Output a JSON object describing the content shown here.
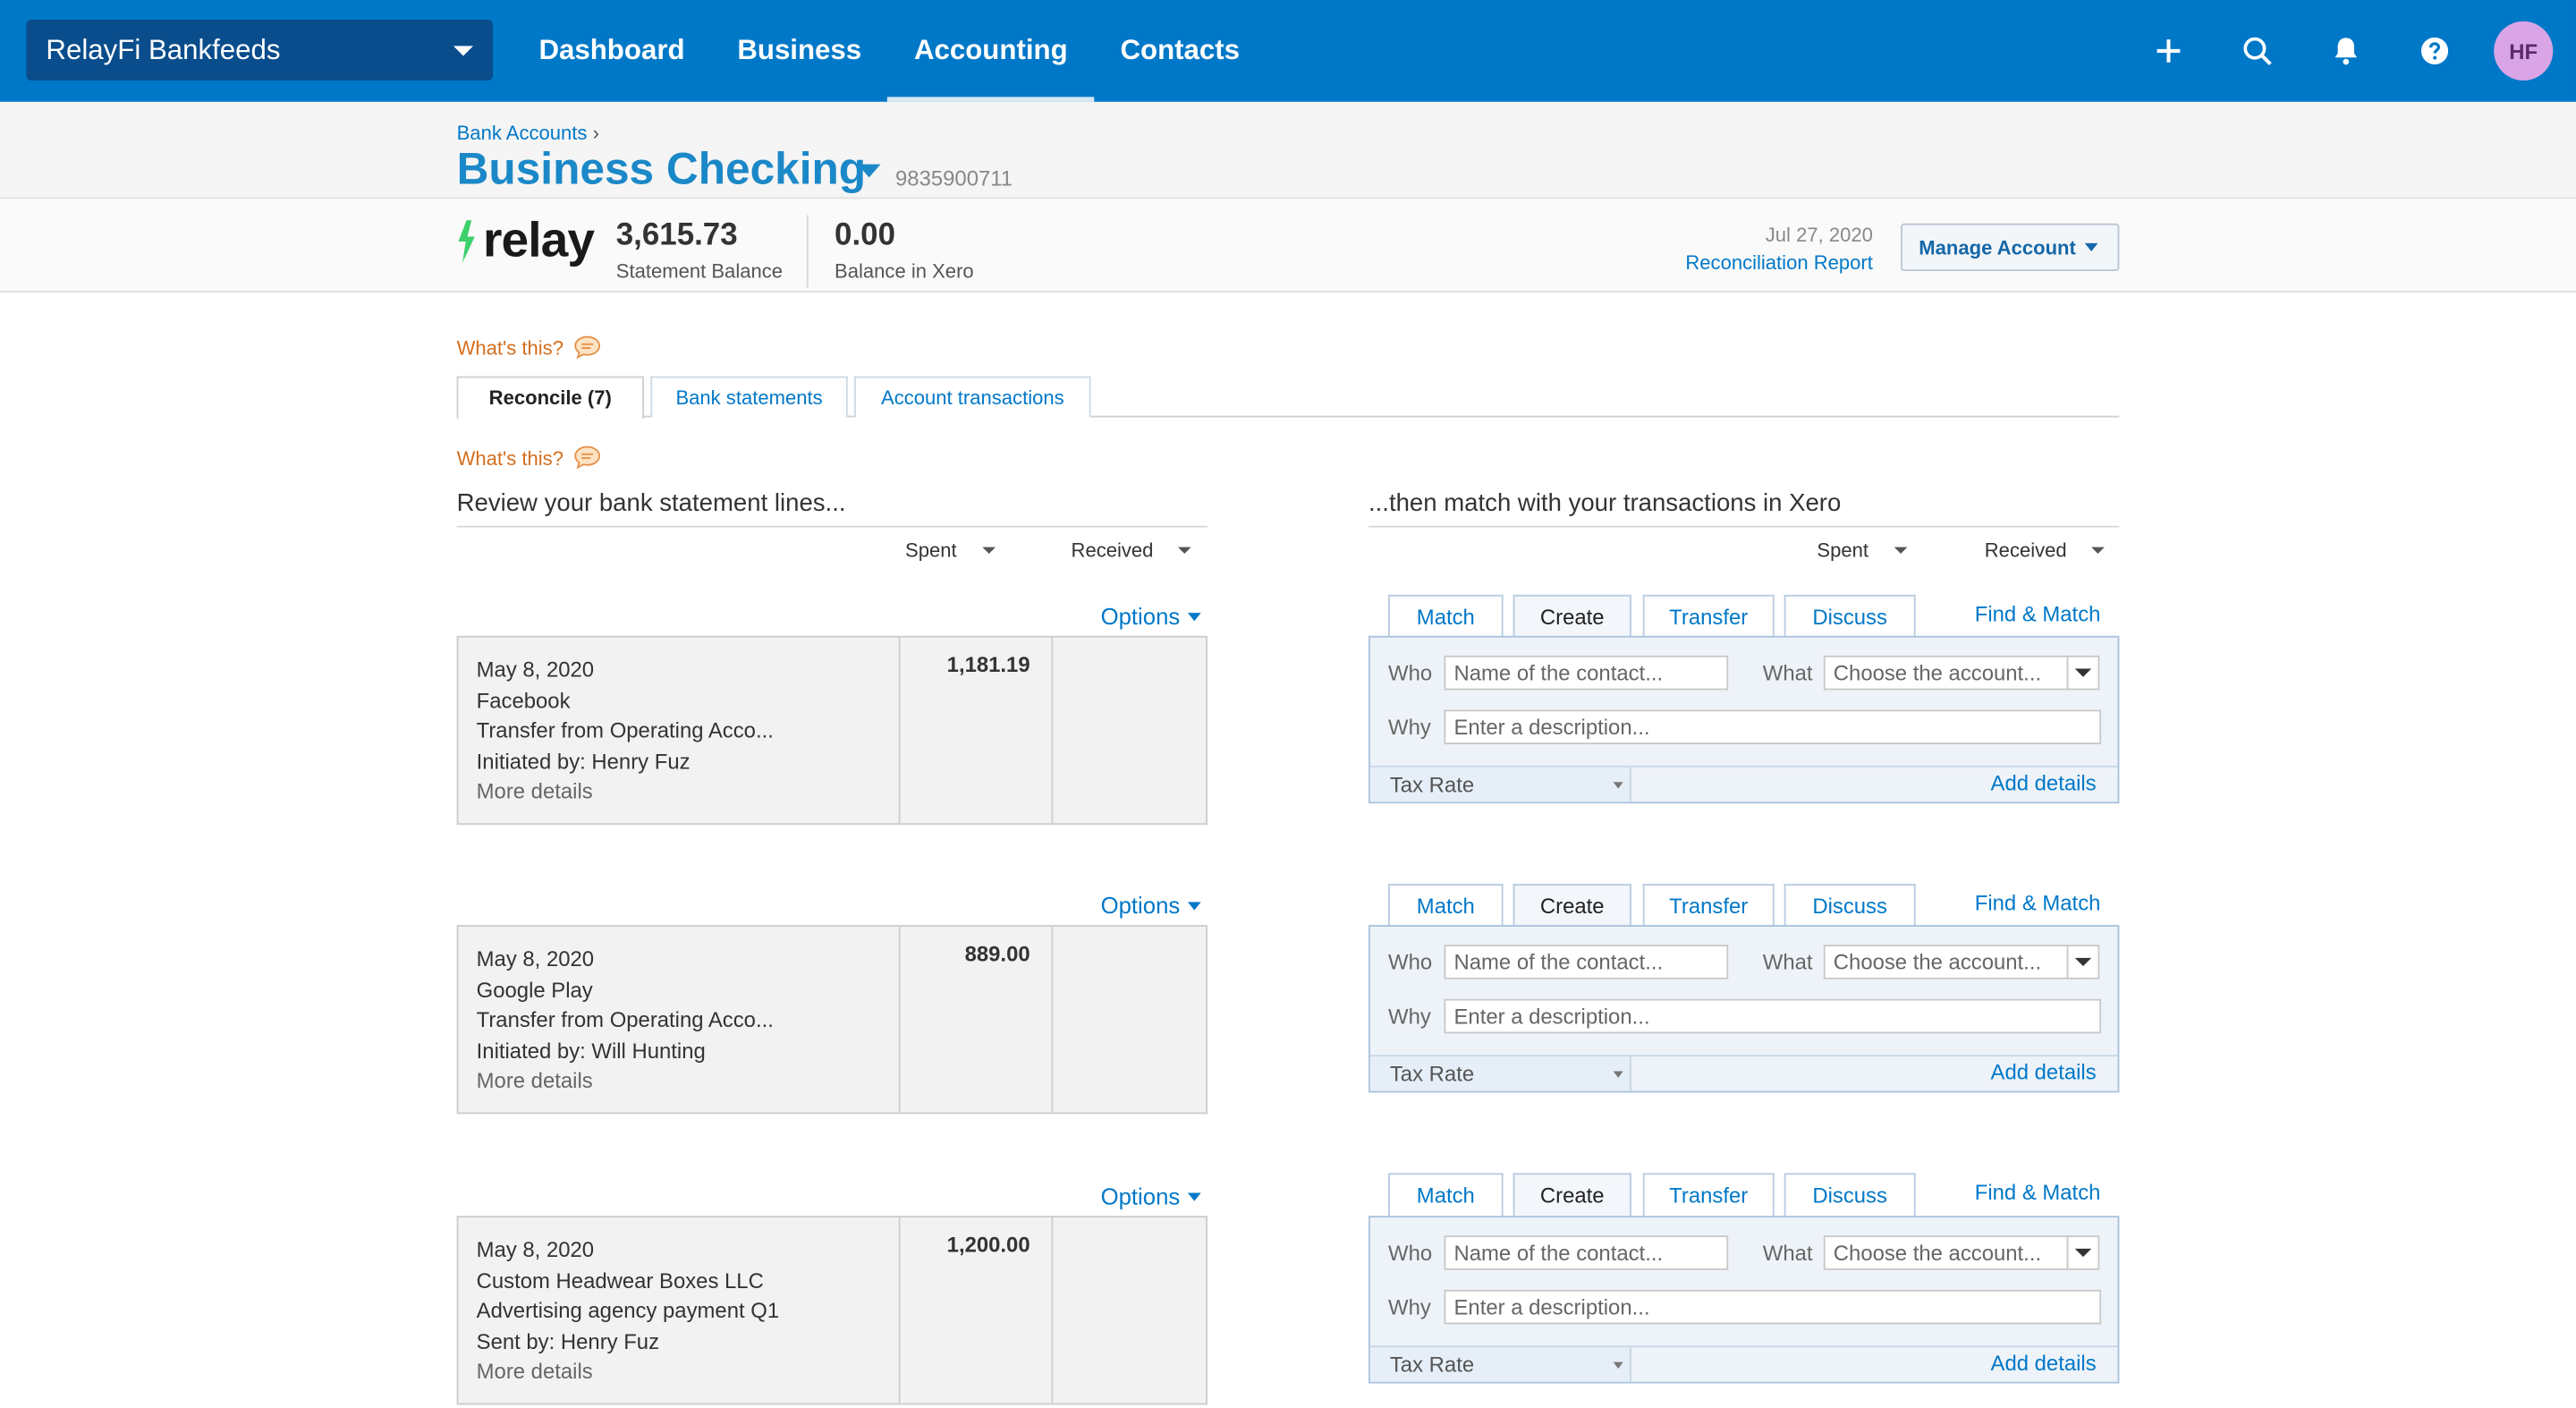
{
  "topbar": {
    "org_name": "RelayFi Bankfeeds",
    "nav": [
      "Dashboard",
      "Business",
      "Accounting",
      "Contacts"
    ],
    "active_nav": "Accounting",
    "avatar_initials": "HF",
    "icons": [
      "plus-icon",
      "search-icon",
      "bell-icon",
      "help-icon"
    ]
  },
  "header": {
    "breadcrumb": "Bank Accounts",
    "breadcrumb_sep": "›",
    "title": "Business Checking",
    "account_number": "9835900711"
  },
  "summary": {
    "logo_text": "relay",
    "statement_balance": "3,615.73",
    "statement_balance_label": "Statement Balance",
    "xero_balance": "0.00",
    "xero_balance_label": "Balance in Xero",
    "report_date": "Jul 27, 2020",
    "report_link": "Reconciliation Report",
    "manage_button": "Manage Account"
  },
  "whats_this": "What's this?",
  "tabs": [
    "Reconcile (7)",
    "Bank statements",
    "Account transactions"
  ],
  "left_heading": "Review your bank statement lines...",
  "right_heading": "...then match with your transactions in Xero",
  "columns": {
    "spent": "Spent",
    "received": "Received"
  },
  "options_label": "Options",
  "more_details_label": "More details",
  "statement_lines": [
    {
      "date": "May 8, 2020",
      "payee": "Facebook",
      "reference": "Transfer from Operating Acco...",
      "initiated": "Initiated by: Henry Fuz",
      "spent": "1,181.19",
      "received": ""
    },
    {
      "date": "May 8, 2020",
      "payee": "Google Play",
      "reference": "Transfer from Operating Acco...",
      "initiated": "Initiated by: Will Hunting",
      "spent": "889.00",
      "received": ""
    },
    {
      "date": "May 8, 2020",
      "payee": "Custom Headwear Boxes LLC",
      "reference": "Advertising agency payment Q1",
      "initiated": "Sent by: Henry Fuz",
      "spent": "1,200.00",
      "received": ""
    }
  ],
  "match_panel": {
    "tabs": [
      "Match",
      "Create",
      "Transfer",
      "Discuss"
    ],
    "active_tab": "Create",
    "find_match": "Find & Match",
    "who_label": "Who",
    "who_placeholder": "Name of the contact...",
    "what_label": "What",
    "what_placeholder": "Choose the account...",
    "why_label": "Why",
    "why_placeholder": "Enter a description...",
    "tax_rate_label": "Tax Rate",
    "add_details": "Add details"
  },
  "colors": {
    "brand_blue": "#0078c8",
    "header_blue": "#0a4d8c",
    "relay_green": "#3dd06b",
    "link_orange": "#d46e1d"
  }
}
